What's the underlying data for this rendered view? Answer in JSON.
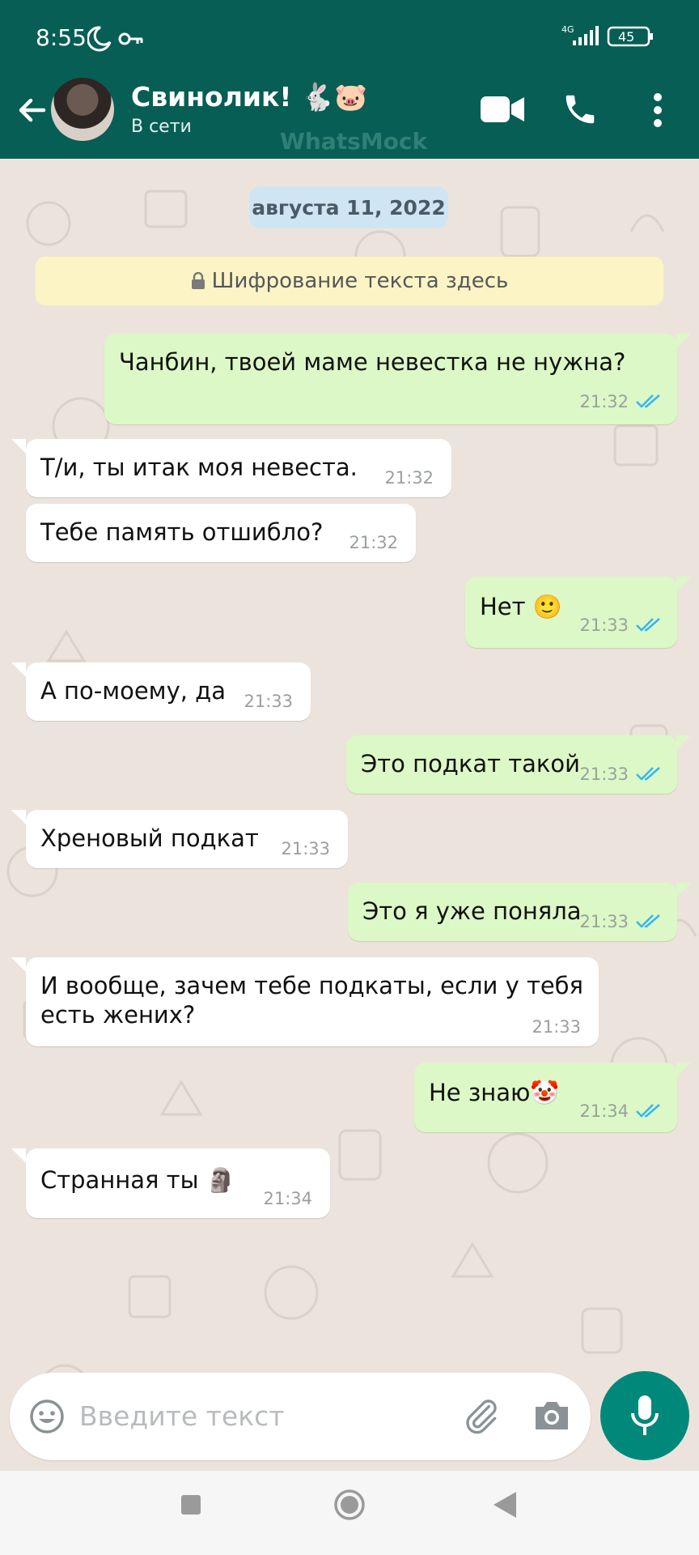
{
  "status_bar": {
    "time": "8:55",
    "network": "4G",
    "battery": "45"
  },
  "header": {
    "contact_name": "Свинолик! 🐇🐷",
    "contact_status": "В сети",
    "watermark": "WhatsMock"
  },
  "chat": {
    "date_label": "августа 11, 2022",
    "encryption_notice": "Шифрование текста здесь",
    "messages": [
      {
        "direction": "out",
        "text": "Чанбин, твоей маме невестка не нужна?",
        "time": "21:32",
        "status": "read"
      },
      {
        "direction": "in",
        "text": "Т/и, ты итак моя невеста.",
        "time": "21:32"
      },
      {
        "direction": "in",
        "text": "Тебе память отшибло?",
        "time": "21:32"
      },
      {
        "direction": "out",
        "text": "Нет 🙂",
        "time": "21:33",
        "status": "read"
      },
      {
        "direction": "in",
        "text": "А по-моему, да",
        "time": "21:33"
      },
      {
        "direction": "out",
        "text": "Это подкат такой",
        "time": "21:33",
        "status": "read"
      },
      {
        "direction": "in",
        "text": "Хреновый подкат",
        "time": "21:33"
      },
      {
        "direction": "out",
        "text": "Это я уже поняла",
        "time": "21:33",
        "status": "read"
      },
      {
        "direction": "in",
        "text_line1": "И вообще, зачем тебе подкаты, если у тебя",
        "text_line2": "есть жених?",
        "time": "21:33"
      },
      {
        "direction": "out",
        "text": "Не знаю🤡",
        "time": "21:34",
        "status": "read"
      },
      {
        "direction": "in",
        "text": "Странная ты 🗿",
        "time": "21:34"
      }
    ]
  },
  "input": {
    "placeholder": "Введите текст"
  },
  "icons": {
    "back": "arrow-left-icon",
    "video": "video-camera-icon",
    "call": "phone-icon",
    "menu": "more-vertical-icon",
    "emoji": "emoji-icon",
    "attach": "paperclip-icon",
    "camera": "camera-icon",
    "mic": "microphone-icon",
    "read_receipt": "double-check-icon"
  },
  "colors": {
    "header": "#075e54",
    "outgoing_bubble": "#dcf8c6",
    "incoming_bubble": "#ffffff",
    "read_tick": "#34b7f1",
    "mic_button": "#00897b"
  }
}
